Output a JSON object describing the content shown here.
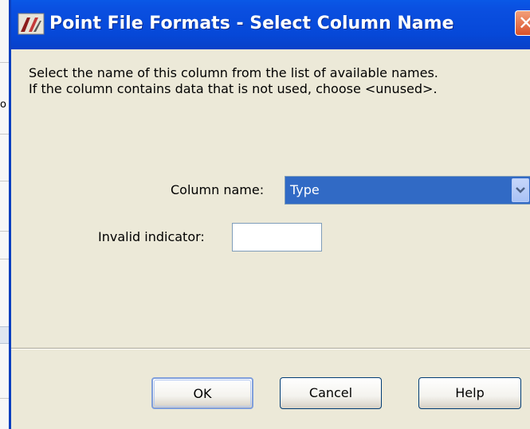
{
  "window": {
    "title": "Point File Formats - Select Column Name",
    "close_glyph": "✕"
  },
  "instructions": {
    "line1": "Select the name of this column from the list of available names.",
    "line2": "If the column contains data that is not used, choose <unused>."
  },
  "column_name": {
    "label": "Column name:",
    "selected_value": "Type"
  },
  "invalid_indicator": {
    "label": "Invalid indicator:",
    "value": ""
  },
  "buttons": {
    "ok": "OK",
    "cancel": "Cancel",
    "help": "Help"
  },
  "background_app": {
    "fragment": "o"
  },
  "colors": {
    "titlebar_blue": "#0648d8",
    "selection_blue": "#316ac5",
    "dialog_face": "#ece9d8",
    "close_red": "#d9512a"
  }
}
